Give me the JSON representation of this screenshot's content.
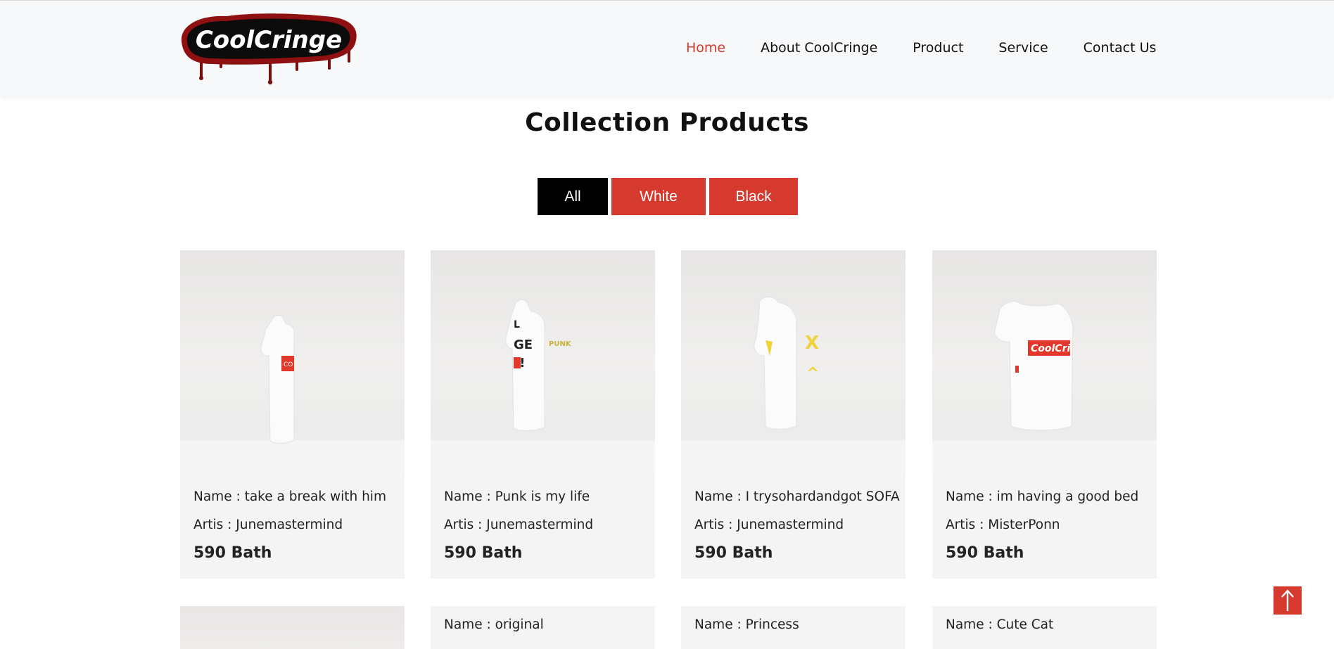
{
  "brand": {
    "logo_text": "CoolCringe"
  },
  "nav": {
    "items": [
      {
        "label": "Home",
        "active": true
      },
      {
        "label": "About CoolCringe",
        "active": false
      },
      {
        "label": "Product",
        "active": false
      },
      {
        "label": "Service",
        "active": false
      },
      {
        "label": "Contact Us",
        "active": false
      }
    ]
  },
  "section": {
    "title": "Collection Products"
  },
  "filters": [
    {
      "label": "All",
      "active": true
    },
    {
      "label": "White",
      "active": false
    },
    {
      "label": "Black",
      "active": false
    }
  ],
  "products": [
    {
      "name": "Name : take a break with him",
      "artist": "Artis : Junemastermind",
      "price": "590 Bath"
    },
    {
      "name": "Name : Punk is my life",
      "artist": "Artis : Junemastermind",
      "price": "590 Bath"
    },
    {
      "name": "Name : I trysohardandgot SOFA",
      "artist": "Artis : Junemastermind",
      "price": "590 Bath"
    },
    {
      "name": "Name : im having a good bed",
      "artist": "Artis : MisterPonn",
      "price": "590 Bath"
    }
  ],
  "products_row2": [
    {
      "name": ""
    },
    {
      "name": "Name : original"
    },
    {
      "name": "Name : Princess"
    },
    {
      "name": "Name : Cute Cat"
    }
  ],
  "colors": {
    "accent": "#d63a2f",
    "active_filter": "#000000",
    "card_bg": "#f4f4f4"
  },
  "icons": {
    "back_to_top": "arrow-up-icon"
  }
}
